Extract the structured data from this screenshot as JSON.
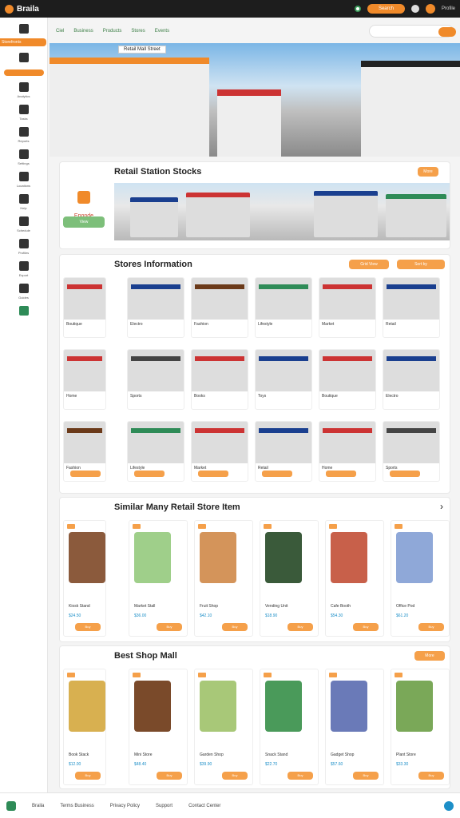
{
  "topbar": {
    "brand": "Braila",
    "pill": "Search",
    "account": "Profile"
  },
  "sidebar": {
    "active": "Storefronts",
    "items": [
      "Storefronts",
      "Inventory",
      "Analytics",
      "Tasks",
      "Reports",
      "Settings",
      "Locations",
      "Help",
      "Schedule",
      "Profiles",
      "Export",
      "Guides",
      "Home"
    ]
  },
  "subnav": {
    "tabs": [
      "Ciel",
      "Business",
      "Products",
      "Stores",
      "Events"
    ]
  },
  "hero": {
    "label": "Retail Mall Street"
  },
  "featured": {
    "title": "Retail Station Stocks",
    "brand": "Eponde",
    "button": "View",
    "corner": "More"
  },
  "shops": {
    "title": "Stores Information",
    "filter1": "Grid View",
    "filter2": "Sort by",
    "captions": [
      "Boutique",
      "Electro",
      "Fashion",
      "Lifestyle",
      "Market",
      "Retail",
      "Home",
      "Sports",
      "Books",
      "Toys"
    ]
  },
  "products": {
    "title": "Similar Many Retail Store Item",
    "next": "›",
    "names": [
      "Kiosk Stand",
      "Market Stall",
      "Fruit Shop",
      "Vending Unit",
      "Cafe Booth",
      "Office Pod"
    ],
    "prices": [
      "$24.50",
      "$36.00",
      "$42.10",
      "$18.90",
      "$54.30",
      "$61.20"
    ],
    "button": "Buy"
  },
  "mall": {
    "title": "Best Shop Mall",
    "corner": "More",
    "names": [
      "Book Stack",
      "Mini Store",
      "Garden Shop",
      "Snack Stand",
      "Gadget Shop",
      "Plant Store"
    ],
    "prices": [
      "$12.00",
      "$48.40",
      "$39.90",
      "$22.70",
      "$57.60",
      "$33.30"
    ]
  },
  "footer": {
    "brand": "Braila",
    "links": [
      "Terms Business",
      "Privacy Policy",
      "Support",
      "Contact Center"
    ]
  },
  "colors": {
    "accent": "#f08a2a",
    "green": "#2e8b57"
  }
}
